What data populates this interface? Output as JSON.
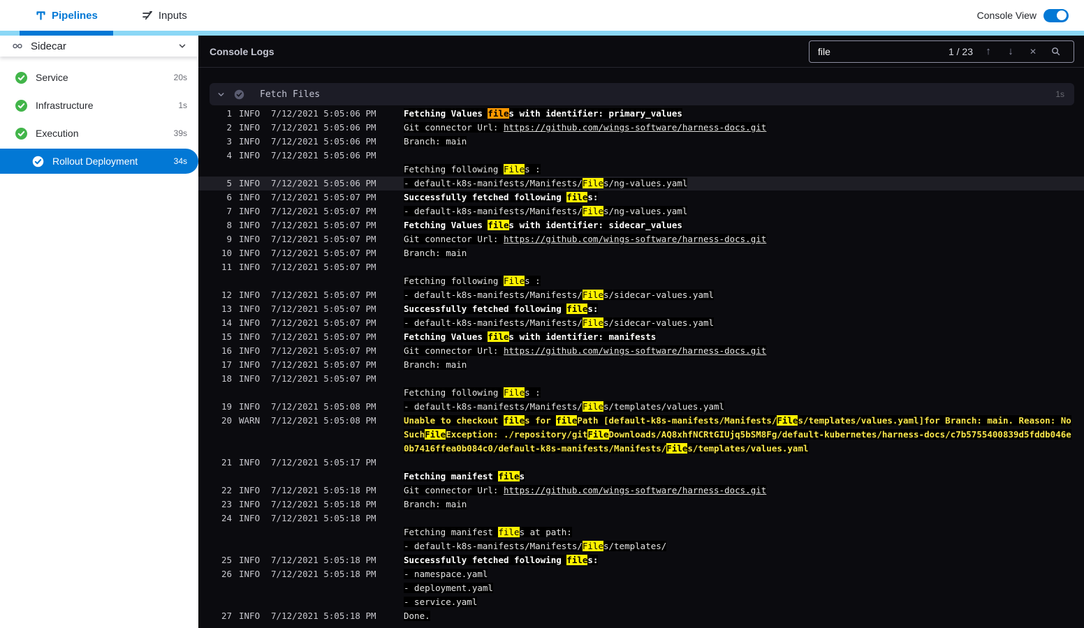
{
  "header": {
    "tabs": [
      {
        "label": "Pipelines"
      },
      {
        "label": "Inputs"
      }
    ],
    "console_view_label": "Console View",
    "accent_color": "#0278d5",
    "strip_color": "#8bd7f6"
  },
  "sidebar": {
    "title": "Sidecar",
    "items": [
      {
        "label": "Service",
        "duration": "20s",
        "status": "success"
      },
      {
        "label": "Infrastructure",
        "duration": "1s",
        "status": "success"
      },
      {
        "label": "Execution",
        "duration": "39s",
        "status": "success"
      },
      {
        "label": "Rollout Deployment",
        "duration": "34s",
        "status": "success",
        "selected": true,
        "indent": true
      }
    ]
  },
  "console": {
    "title": "Console Logs",
    "search": {
      "value": "file",
      "counter": "1 / 23"
    },
    "section": {
      "title": "Fetch Files",
      "duration": "1s"
    },
    "highlight_colors": {
      "match": "#fff200",
      "current_match": "#ff9800",
      "warn_text": "#f9e64a"
    },
    "logs": [
      {
        "n": 1,
        "lv": "INFO",
        "t": "7/12/2021 5:05:06 PM",
        "s": "b",
        "rows": [
          [
            [
              "p",
              "Fetching Values "
            ],
            [
              "c",
              "file"
            ],
            [
              "p",
              "s with identifier: primary_values"
            ]
          ]
        ]
      },
      {
        "n": 2,
        "lv": "INFO",
        "t": "7/12/2021 5:05:06 PM",
        "s": "n",
        "rows": [
          [
            [
              "p",
              "Git connector Url: "
            ],
            [
              "l",
              "https://github.com/wings-software/harness-docs.git"
            ]
          ]
        ]
      },
      {
        "n": 3,
        "lv": "INFO",
        "t": "7/12/2021 5:05:06 PM",
        "s": "n",
        "rows": [
          [
            [
              "p",
              "Branch: main"
            ]
          ]
        ]
      },
      {
        "n": 4,
        "lv": "INFO",
        "t": "7/12/2021 5:05:06 PM",
        "s": "n",
        "rows": [
          [],
          [
            [
              "p",
              "Fetching following "
            ],
            [
              "m",
              "File"
            ],
            [
              "p",
              "s :"
            ]
          ]
        ]
      },
      {
        "n": 5,
        "lv": "INFO",
        "t": "7/12/2021 5:05:06 PM",
        "s": "n",
        "sel": true,
        "rows": [
          [
            [
              "p",
              "- default-k8s-manifests/Manifests/"
            ],
            [
              "m",
              "File"
            ],
            [
              "p",
              "s/ng-values.yaml"
            ]
          ]
        ]
      },
      {
        "n": 6,
        "lv": "INFO",
        "t": "7/12/2021 5:05:07 PM",
        "s": "b",
        "rows": [
          [
            [
              "p",
              "Successfully fetched following "
            ],
            [
              "m",
              "file"
            ],
            [
              "p",
              "s:"
            ]
          ]
        ]
      },
      {
        "n": 7,
        "lv": "INFO",
        "t": "7/12/2021 5:05:07 PM",
        "s": "n",
        "rows": [
          [
            [
              "p",
              "- default-k8s-manifests/Manifests/"
            ],
            [
              "m",
              "File"
            ],
            [
              "p",
              "s/ng-values.yaml"
            ]
          ]
        ]
      },
      {
        "n": 8,
        "lv": "INFO",
        "t": "7/12/2021 5:05:07 PM",
        "s": "b",
        "rows": [
          [
            [
              "p",
              "Fetching Values "
            ],
            [
              "m",
              "file"
            ],
            [
              "p",
              "s with identifier: sidecar_values"
            ]
          ]
        ]
      },
      {
        "n": 9,
        "lv": "INFO",
        "t": "7/12/2021 5:05:07 PM",
        "s": "n",
        "rows": [
          [
            [
              "p",
              "Git connector Url: "
            ],
            [
              "l",
              "https://github.com/wings-software/harness-docs.git"
            ]
          ]
        ]
      },
      {
        "n": 10,
        "lv": "INFO",
        "t": "7/12/2021 5:05:07 PM",
        "s": "n",
        "rows": [
          [
            [
              "p",
              "Branch: main"
            ]
          ]
        ]
      },
      {
        "n": 11,
        "lv": "INFO",
        "t": "7/12/2021 5:05:07 PM",
        "s": "n",
        "rows": [
          [],
          [
            [
              "p",
              "Fetching following "
            ],
            [
              "m",
              "File"
            ],
            [
              "p",
              "s :"
            ]
          ]
        ]
      },
      {
        "n": 12,
        "lv": "INFO",
        "t": "7/12/2021 5:05:07 PM",
        "s": "n",
        "rows": [
          [
            [
              "p",
              "- default-k8s-manifests/Manifests/"
            ],
            [
              "m",
              "File"
            ],
            [
              "p",
              "s/sidecar-values.yaml"
            ]
          ]
        ]
      },
      {
        "n": 13,
        "lv": "INFO",
        "t": "7/12/2021 5:05:07 PM",
        "s": "b",
        "rows": [
          [
            [
              "p",
              "Successfully fetched following "
            ],
            [
              "m",
              "file"
            ],
            [
              "p",
              "s:"
            ]
          ]
        ]
      },
      {
        "n": 14,
        "lv": "INFO",
        "t": "7/12/2021 5:05:07 PM",
        "s": "n",
        "rows": [
          [
            [
              "p",
              "- default-k8s-manifests/Manifests/"
            ],
            [
              "m",
              "File"
            ],
            [
              "p",
              "s/sidecar-values.yaml"
            ]
          ]
        ]
      },
      {
        "n": 15,
        "lv": "INFO",
        "t": "7/12/2021 5:05:07 PM",
        "s": "b",
        "rows": [
          [
            [
              "p",
              "Fetching Values "
            ],
            [
              "m",
              "file"
            ],
            [
              "p",
              "s with identifier: manifests"
            ]
          ]
        ]
      },
      {
        "n": 16,
        "lv": "INFO",
        "t": "7/12/2021 5:05:07 PM",
        "s": "n",
        "rows": [
          [
            [
              "p",
              "Git connector Url: "
            ],
            [
              "l",
              "https://github.com/wings-software/harness-docs.git"
            ]
          ]
        ]
      },
      {
        "n": 17,
        "lv": "INFO",
        "t": "7/12/2021 5:05:07 PM",
        "s": "n",
        "rows": [
          [
            [
              "p",
              "Branch: main"
            ]
          ]
        ]
      },
      {
        "n": 18,
        "lv": "INFO",
        "t": "7/12/2021 5:05:07 PM",
        "s": "n",
        "rows": [
          [],
          [
            [
              "p",
              "Fetching following "
            ],
            [
              "m",
              "File"
            ],
            [
              "p",
              "s :"
            ]
          ]
        ]
      },
      {
        "n": 19,
        "lv": "INFO",
        "t": "7/12/2021 5:05:08 PM",
        "s": "n",
        "rows": [
          [
            [
              "p",
              "- default-k8s-manifests/Manifests/"
            ],
            [
              "m",
              "File"
            ],
            [
              "p",
              "s/templates/values.yaml"
            ]
          ]
        ]
      },
      {
        "n": 20,
        "lv": "WARN",
        "t": "7/12/2021 5:05:08 PM",
        "s": "w",
        "rows": [
          [
            [
              "p",
              "Unable to checkout "
            ],
            [
              "m",
              "file"
            ],
            [
              "p",
              "s for "
            ],
            [
              "m",
              "file"
            ],
            [
              "p",
              "Path [default-k8s-manifests/Manifests/"
            ],
            [
              "m",
              "File"
            ],
            [
              "p",
              "s/templates/values.yaml]for Branch: main. Reason: NoSuch"
            ],
            [
              "m",
              "File"
            ],
            [
              "p",
              "Exception: ./repository/git"
            ],
            [
              "m",
              "File"
            ],
            [
              "p",
              "Downloads/AQ8xhfNCRtGIUjq5bSM8Fg/default-kubernetes/harness-docs/c7b5755400839d5fddb046e0b7416ffea0b084c0/default-k8s-manifests/Manifests/"
            ],
            [
              "m",
              "File"
            ],
            [
              "p",
              "s/templates/values.yaml"
            ]
          ]
        ]
      },
      {
        "n": 21,
        "lv": "INFO",
        "t": "7/12/2021 5:05:17 PM",
        "s": "b",
        "rows": [
          [],
          [
            [
              "p",
              "Fetching manifest "
            ],
            [
              "m",
              "file"
            ],
            [
              "p",
              "s"
            ]
          ]
        ]
      },
      {
        "n": 22,
        "lv": "INFO",
        "t": "7/12/2021 5:05:18 PM",
        "s": "n",
        "rows": [
          [
            [
              "p",
              "Git connector Url: "
            ],
            [
              "l",
              "https://github.com/wings-software/harness-docs.git"
            ]
          ]
        ]
      },
      {
        "n": 23,
        "lv": "INFO",
        "t": "7/12/2021 5:05:18 PM",
        "s": "n",
        "rows": [
          [
            [
              "p",
              "Branch: main"
            ]
          ]
        ]
      },
      {
        "n": 24,
        "lv": "INFO",
        "t": "7/12/2021 5:05:18 PM",
        "s": "n",
        "rows": [
          [],
          [
            [
              "p",
              "Fetching manifest "
            ],
            [
              "m",
              "file"
            ],
            [
              "p",
              "s at path:"
            ]
          ],
          [
            [
              "p",
              "- default-k8s-manifests/Manifests/"
            ],
            [
              "m",
              "File"
            ],
            [
              "p",
              "s/templates/"
            ]
          ]
        ]
      },
      {
        "n": 25,
        "lv": "INFO",
        "t": "7/12/2021 5:05:18 PM",
        "s": "b",
        "rows": [
          [
            [
              "p",
              "Successfully fetched following "
            ],
            [
              "m",
              "file"
            ],
            [
              "p",
              "s:"
            ]
          ]
        ]
      },
      {
        "n": 26,
        "lv": "INFO",
        "t": "7/12/2021 5:05:18 PM",
        "s": "n",
        "rows": [
          [
            [
              "p",
              "- namespace.yaml"
            ]
          ],
          [
            [
              "p",
              "- deployment.yaml"
            ]
          ],
          [
            [
              "p",
              "- service.yaml"
            ]
          ]
        ]
      },
      {
        "n": 27,
        "lv": "INFO",
        "t": "7/12/2021 5:05:18 PM",
        "s": "n",
        "rows": [
          [
            [
              "p",
              "Done."
            ]
          ]
        ]
      }
    ]
  }
}
